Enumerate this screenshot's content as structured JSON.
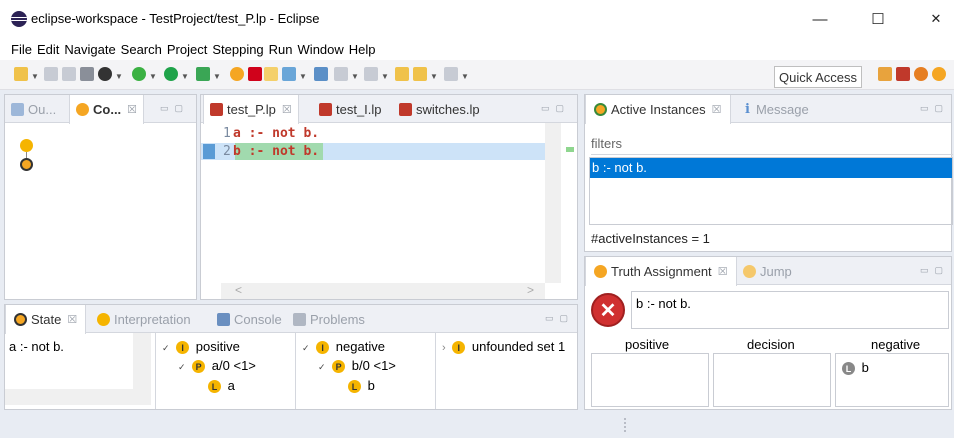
{
  "window": {
    "title": "eclipse-workspace - TestProject/test_P.lp - Eclipse",
    "minimize": "—",
    "maximize": "☐",
    "close": "✕"
  },
  "menu": [
    "File",
    "Edit",
    "Navigate",
    "Search",
    "Project",
    "Stepping",
    "Run",
    "Window",
    "Help"
  ],
  "toolbar": {
    "quick_access": "Quick Access"
  },
  "left_top": {
    "tabs": [
      {
        "label": "Ou...",
        "close": ""
      },
      {
        "label": "Co...",
        "close": "☒"
      }
    ]
  },
  "editor": {
    "tabs": [
      {
        "label": "test_P.lp",
        "close": "☒"
      },
      {
        "label": "test_I.lp",
        "close": ""
      },
      {
        "label": "switches.lp",
        "close": ""
      }
    ],
    "lines": [
      {
        "num": "1",
        "text": "a :- not b."
      },
      {
        "num": "2",
        "text": "b :- not b."
      }
    ],
    "scroll_left": "<",
    "scroll_right": ">"
  },
  "active_instances": {
    "tabs": [
      {
        "label": "Active Instances",
        "close": "☒"
      },
      {
        "label": "Message",
        "close": ""
      }
    ],
    "filters_label": "filters",
    "items": [
      "b :- not b."
    ],
    "count_text": "#activeInstances = 1"
  },
  "truth": {
    "tabs": [
      {
        "label": "Truth Assignment",
        "close": "☒"
      },
      {
        "label": "Jump",
        "close": ""
      }
    ],
    "rule": "b :- not b.",
    "columns": [
      "positive",
      "decision",
      "negative"
    ],
    "negative_items": [
      {
        "badge": "L",
        "label": "b"
      }
    ]
  },
  "state": {
    "tabs": [
      {
        "label": "State",
        "close": "☒"
      },
      {
        "label": "Interpretation",
        "close": ""
      },
      {
        "label": "Console",
        "close": ""
      },
      {
        "label": "Problems",
        "close": ""
      }
    ],
    "rule_list": [
      "a :- not b."
    ],
    "positive": {
      "label": "positive",
      "pred": "a/0 <1>",
      "leaf": "a"
    },
    "negative": {
      "label": "negative",
      "pred": "b/0 <1>",
      "leaf": "b"
    },
    "unfounded": {
      "label": "unfounded set 1"
    },
    "badges": {
      "i": "I",
      "p": "P",
      "l": "L"
    }
  },
  "colors": {
    "accent": "#0078d7",
    "keyword": "#c0392b",
    "highlight": "#cde3f8",
    "match": "#7fc97f",
    "error": "#d03030"
  }
}
